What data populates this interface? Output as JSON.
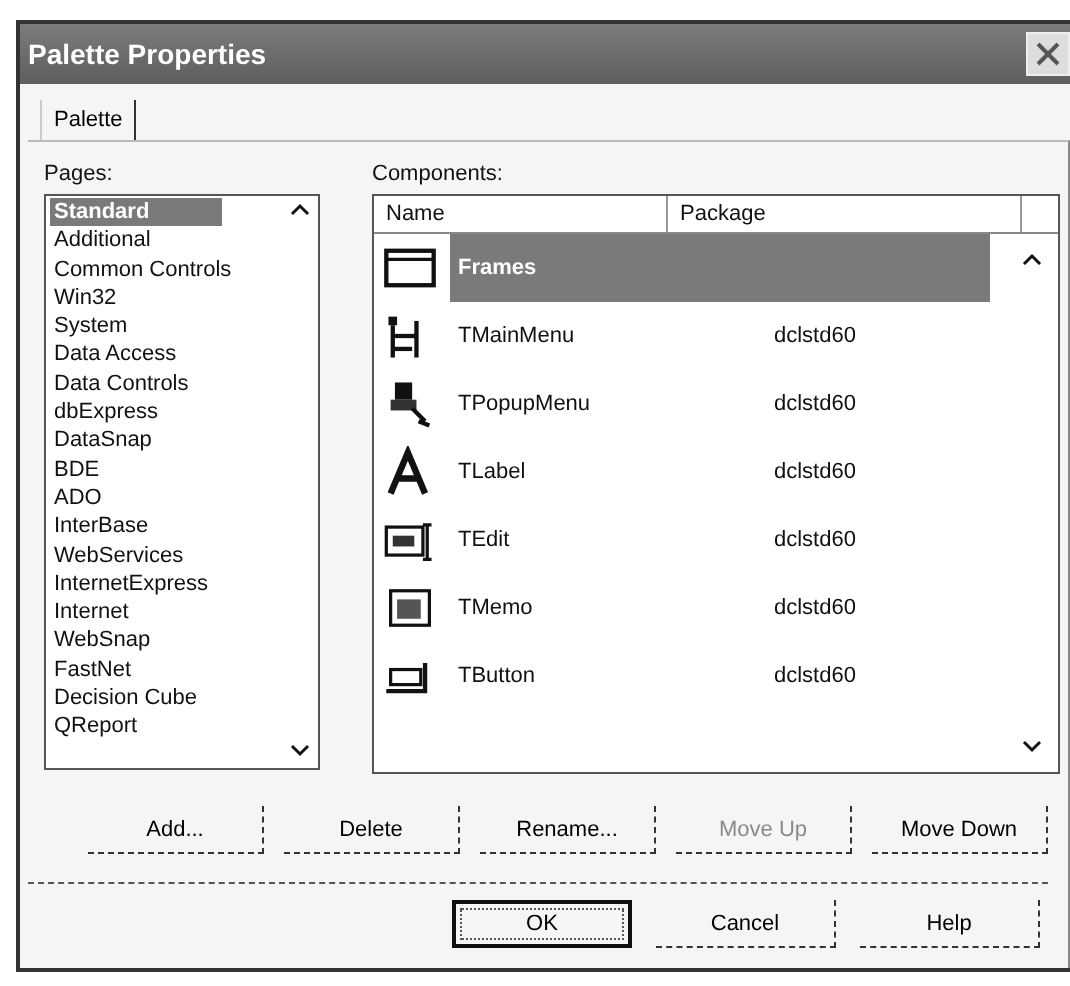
{
  "window": {
    "title": "Palette Properties"
  },
  "tabs": [
    {
      "label": "Palette",
      "selected": true
    }
  ],
  "pages": {
    "label": "Pages:",
    "items": [
      {
        "label": "Standard",
        "selected": true
      },
      {
        "label": "Additional",
        "selected": false
      },
      {
        "label": "Common Controls",
        "selected": false
      },
      {
        "label": "Win32",
        "selected": false
      },
      {
        "label": "System",
        "selected": false
      },
      {
        "label": "Data Access",
        "selected": false
      },
      {
        "label": "Data Controls",
        "selected": false
      },
      {
        "label": "dbExpress",
        "selected": false
      },
      {
        "label": "DataSnap",
        "selected": false
      },
      {
        "label": "BDE",
        "selected": false
      },
      {
        "label": "ADO",
        "selected": false
      },
      {
        "label": "InterBase",
        "selected": false
      },
      {
        "label": "WebServices",
        "selected": false
      },
      {
        "label": "InternetExpress",
        "selected": false
      },
      {
        "label": "Internet",
        "selected": false
      },
      {
        "label": "WebSnap",
        "selected": false
      },
      {
        "label": "FastNet",
        "selected": false
      },
      {
        "label": "Decision Cube",
        "selected": false
      },
      {
        "label": "QReport",
        "selected": false
      }
    ]
  },
  "components": {
    "label": "Components:",
    "columns": [
      "Name",
      "Package"
    ],
    "rows": [
      {
        "name": "Frames",
        "selected": true
      },
      {
        "name": "TMainMenu",
        "package": "dclstd60",
        "selected": false
      },
      {
        "name": "TPopupMenu",
        "package": "dclstd60",
        "selected": false
      },
      {
        "name": "TLabel",
        "package": "dclstd60",
        "selected": false
      },
      {
        "name": "TEdit",
        "package": "dclstd60",
        "selected": false
      },
      {
        "name": "TMemo",
        "package": "dclstd60",
        "selected": false
      },
      {
        "name": "TButton",
        "package": "dclstd60",
        "selected": false
      }
    ]
  },
  "actions": [
    {
      "label": "Add...",
      "disabled": false
    },
    {
      "label": "Delete",
      "disabled": false
    },
    {
      "label": "Rename...",
      "disabled": false
    },
    {
      "label": "Move Up",
      "disabled": true
    },
    {
      "label": "Move Down",
      "disabled": false
    }
  ],
  "buttons": [
    {
      "label": "OK",
      "default": true
    },
    {
      "label": "Cancel",
      "default": false
    },
    {
      "label": "Help",
      "default": false
    }
  ]
}
